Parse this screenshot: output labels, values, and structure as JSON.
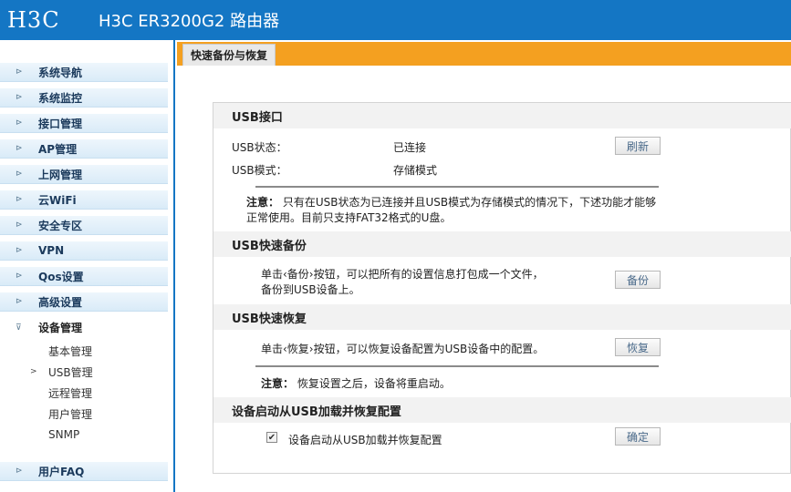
{
  "header": {
    "logo_text": "H3C",
    "title": "H3C ER3200G2 路由器"
  },
  "sidebar": {
    "items": [
      {
        "label": "系统导航"
      },
      {
        "label": "系统监控"
      },
      {
        "label": "接口管理"
      },
      {
        "label": "AP管理"
      },
      {
        "label": "上网管理"
      },
      {
        "label": "云WiFi"
      },
      {
        "label": "安全专区"
      },
      {
        "label": "VPN"
      },
      {
        "label": "Qos设置"
      },
      {
        "label": "高级设置"
      },
      {
        "label": "设备管理"
      }
    ],
    "subitems": [
      {
        "label": "基本管理"
      },
      {
        "label": "USB管理",
        "marker": ">"
      },
      {
        "label": "远程管理"
      },
      {
        "label": "用户管理"
      },
      {
        "label": "SNMP"
      }
    ],
    "faq": {
      "label": "用户FAQ"
    },
    "collapsed_arrow": "⊳",
    "expanded_arrow": "⊽"
  },
  "tab": {
    "label": "快速备份与恢复"
  },
  "usb_interface": {
    "heading": "USB接口",
    "status_label": "USB状态：",
    "status_value": "已连接",
    "mode_label": "USB模式：",
    "mode_value": "存储模式",
    "refresh_button": "刷新",
    "note_label": "注意：",
    "note_text": "只有在USB状态为已连接并且USB模式为存储模式的情况下，下述功能才能够正常使用。目前只支持FAT32格式的U盘。"
  },
  "usb_backup": {
    "heading": "USB快速备份",
    "desc_line1": "单击‹备份›按钮，可以把所有的设置信息打包成一个文件，",
    "desc_line2": "备份到USB设备上。",
    "button": "备份"
  },
  "usb_restore": {
    "heading": "USB快速恢复",
    "desc": "单击‹恢复›按钮，可以恢复设备配置为USB设备中的配置。",
    "button": "恢复",
    "note_label": "注意：",
    "note_text": "恢复设置之后，设备将重启动。"
  },
  "usb_boot": {
    "heading": "设备启动从USB加载并恢复配置",
    "checkbox_label": "设备启动从USB加载并恢复配置",
    "checked": true,
    "checkbox_mark": "✔",
    "button": "确定"
  }
}
